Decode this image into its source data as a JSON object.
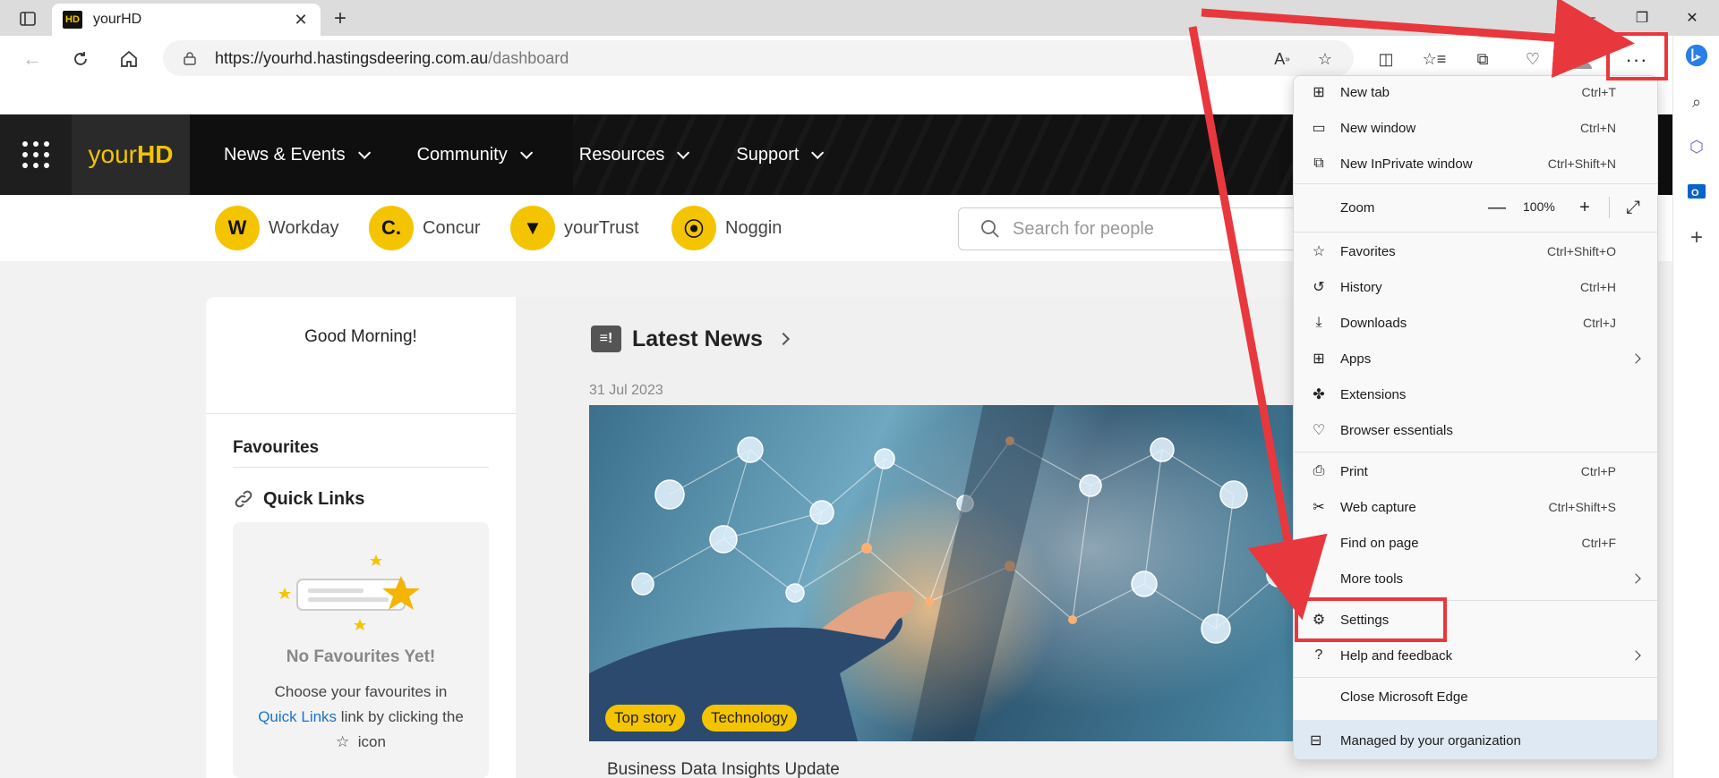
{
  "browser": {
    "tab_title": "yourHD",
    "favicon_text": "HD",
    "url_host": "https://yourhd.hastingsdeering.com.au",
    "url_path": "/dashboard"
  },
  "site": {
    "logo_prefix": "your",
    "logo_suffix": "HD",
    "nav": [
      "News & Events",
      "Community",
      "Resources",
      "Support"
    ],
    "quick_apps": [
      {
        "label": "Workday",
        "badge": "W"
      },
      {
        "label": "Concur",
        "badge": "C."
      },
      {
        "label": "yourTrust",
        "badge": "▼"
      },
      {
        "label": "Noggin",
        "badge": "⦿"
      }
    ],
    "search_placeholder": "Search for people",
    "greeting": "Good Morning!",
    "favourites_title": "Favourites",
    "quick_links_title": "Quick Links",
    "empty_title": "No Favourites Yet!",
    "empty_text_1": "Choose your favourites in",
    "empty_link": "Quick Links",
    "empty_text_2": "link by clicking the",
    "empty_text_3": "icon",
    "news_title": "Latest News",
    "news_date": "31 Jul 2023",
    "tags": [
      "Top story",
      "Technology"
    ],
    "article_title": "Business Data Insights Update"
  },
  "menu": {
    "items": [
      {
        "label": "New tab",
        "shortcut": "Ctrl+T",
        "icon": "new-tab-icon"
      },
      {
        "label": "New window",
        "shortcut": "Ctrl+N",
        "icon": "new-window-icon"
      },
      {
        "label": "New InPrivate window",
        "shortcut": "Ctrl+Shift+N",
        "icon": "inprivate-icon"
      },
      {
        "label": "Zoom",
        "shortcut": "",
        "icon": ""
      },
      {
        "label": "Favorites",
        "shortcut": "Ctrl+Shift+O",
        "icon": "favorites-icon"
      },
      {
        "label": "History",
        "shortcut": "Ctrl+H",
        "icon": "history-icon"
      },
      {
        "label": "Downloads",
        "shortcut": "Ctrl+J",
        "icon": "download-icon"
      },
      {
        "label": "Apps",
        "shortcut": "",
        "icon": "apps-icon"
      },
      {
        "label": "Extensions",
        "shortcut": "",
        "icon": "extensions-icon"
      },
      {
        "label": "Browser essentials",
        "shortcut": "",
        "icon": "heart-pulse-icon"
      },
      {
        "label": "Print",
        "shortcut": "Ctrl+P",
        "icon": "print-icon"
      },
      {
        "label": "Web capture",
        "shortcut": "Ctrl+Shift+S",
        "icon": "web-capture-icon"
      },
      {
        "label": "Find on page",
        "shortcut": "Ctrl+F",
        "icon": "find-icon"
      },
      {
        "label": "More tools",
        "shortcut": "",
        "icon": ""
      },
      {
        "label": "Settings",
        "shortcut": "",
        "icon": "gear-icon"
      },
      {
        "label": "Help and feedback",
        "shortcut": "",
        "icon": "help-icon"
      },
      {
        "label": "Close Microsoft Edge",
        "shortcut": "",
        "icon": ""
      },
      {
        "label": "Managed by your organization",
        "shortcut": "",
        "icon": "briefcase-icon"
      }
    ],
    "zoom_value": "100%"
  },
  "colors": {
    "brand_yellow": "#f5c400",
    "annotation_red": "#e8383d",
    "link_blue": "#1a73c8"
  }
}
